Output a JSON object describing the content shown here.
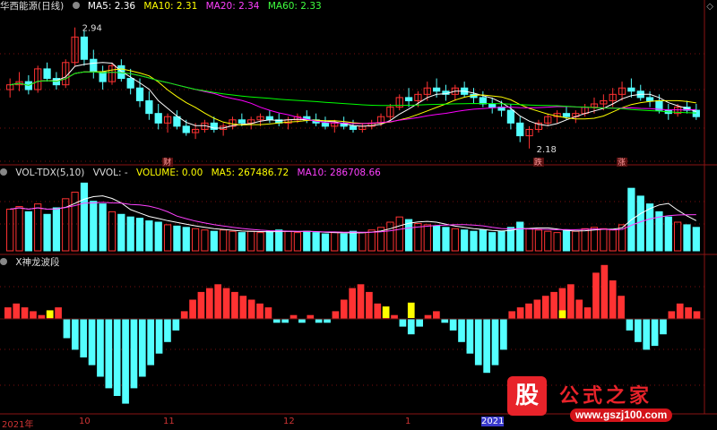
{
  "main_header": {
    "stock": "华西能源(日线)",
    "ma5": "MA5: 2.36",
    "ma10": "MA10: 2.31",
    "ma20": "MA20: 2.34",
    "ma60": "MA60: 2.33"
  },
  "vol_header": {
    "name": "VOL-TDX(5,10)",
    "vvol": "VVOL: -",
    "volume": "VOLUME: 0.00",
    "ma5": "MA5: 267486.72",
    "ma10": "MA10: 286708.66"
  },
  "ind_header": {
    "name": "X神龙波段"
  },
  "annotations": {
    "high": "2.94",
    "low": "2.18",
    "mark1": "财",
    "mark2": "跌",
    "mark3": "涨"
  },
  "x_axis": [
    "2021年",
    "10",
    "11",
    "12",
    "1",
    "2021"
  ],
  "colors": {
    "up": "#ff3232",
    "down": "#54ffff",
    "ma5": "#ffffff",
    "ma10": "#ffff00",
    "ma20": "#ff00ff",
    "ma60": "#00ff00",
    "yellow": "#ffff00"
  },
  "logo": {
    "mark": "股",
    "title": "公式之家",
    "url": "www.gszj100.com"
  },
  "chart_data": [
    {
      "type": "candlestick",
      "title": "华西能源(日线)",
      "series": [
        {
          "name": "K",
          "ohlc": [
            [
              2.55,
              2.62,
              2.5,
              2.58
            ],
            [
              2.58,
              2.66,
              2.54,
              2.6
            ],
            [
              2.6,
              2.64,
              2.52,
              2.55
            ],
            [
              2.55,
              2.7,
              2.53,
              2.68
            ],
            [
              2.68,
              2.72,
              2.6,
              2.62
            ],
            [
              2.62,
              2.66,
              2.55,
              2.58
            ],
            [
              2.58,
              2.74,
              2.56,
              2.72
            ],
            [
              2.72,
              2.94,
              2.7,
              2.88
            ],
            [
              2.88,
              2.92,
              2.7,
              2.74
            ],
            [
              2.74,
              2.8,
              2.62,
              2.66
            ],
            [
              2.66,
              2.7,
              2.55,
              2.6
            ],
            [
              2.6,
              2.72,
              2.58,
              2.7
            ],
            [
              2.7,
              2.74,
              2.6,
              2.62
            ],
            [
              2.62,
              2.68,
              2.52,
              2.56
            ],
            [
              2.56,
              2.62,
              2.44,
              2.48
            ],
            [
              2.48,
              2.54,
              2.36,
              2.4
            ],
            [
              2.4,
              2.46,
              2.3,
              2.34
            ],
            [
              2.34,
              2.4,
              2.28,
              2.38
            ],
            [
              2.38,
              2.42,
              2.3,
              2.32
            ],
            [
              2.32,
              2.36,
              2.26,
              2.28
            ],
            [
              2.28,
              2.34,
              2.24,
              2.3
            ],
            [
              2.3,
              2.36,
              2.28,
              2.34
            ],
            [
              2.34,
              2.38,
              2.28,
              2.3
            ],
            [
              2.3,
              2.34,
              2.26,
              2.32
            ],
            [
              2.32,
              2.38,
              2.3,
              2.36
            ],
            [
              2.36,
              2.4,
              2.32,
              2.34
            ],
            [
              2.34,
              2.38,
              2.3,
              2.36
            ],
            [
              2.36,
              2.4,
              2.32,
              2.38
            ],
            [
              2.38,
              2.42,
              2.34,
              2.36
            ],
            [
              2.36,
              2.4,
              2.32,
              2.34
            ],
            [
              2.34,
              2.38,
              2.3,
              2.36
            ],
            [
              2.36,
              2.4,
              2.34,
              2.38
            ],
            [
              2.38,
              2.42,
              2.34,
              2.36
            ],
            [
              2.36,
              2.4,
              2.32,
              2.34
            ],
            [
              2.34,
              2.38,
              2.3,
              2.32
            ],
            [
              2.32,
              2.36,
              2.28,
              2.34
            ],
            [
              2.34,
              2.38,
              2.3,
              2.32
            ],
            [
              2.32,
              2.36,
              2.28,
              2.3
            ],
            [
              2.3,
              2.34,
              2.28,
              2.32
            ],
            [
              2.32,
              2.36,
              2.3,
              2.34
            ],
            [
              2.34,
              2.4,
              2.32,
              2.38
            ],
            [
              2.38,
              2.46,
              2.36,
              2.44
            ],
            [
              2.44,
              2.52,
              2.42,
              2.5
            ],
            [
              2.5,
              2.56,
              2.44,
              2.48
            ],
            [
              2.48,
              2.54,
              2.44,
              2.52
            ],
            [
              2.52,
              2.6,
              2.48,
              2.56
            ],
            [
              2.56,
              2.62,
              2.5,
              2.54
            ],
            [
              2.54,
              2.58,
              2.48,
              2.52
            ],
            [
              2.52,
              2.58,
              2.48,
              2.56
            ],
            [
              2.56,
              2.6,
              2.5,
              2.52
            ],
            [
              2.52,
              2.56,
              2.46,
              2.5
            ],
            [
              2.5,
              2.54,
              2.44,
              2.46
            ],
            [
              2.46,
              2.5,
              2.4,
              2.44
            ],
            [
              2.44,
              2.48,
              2.38,
              2.42
            ],
            [
              2.42,
              2.46,
              2.3,
              2.34
            ],
            [
              2.34,
              2.38,
              2.22,
              2.26
            ],
            [
              2.26,
              2.32,
              2.18,
              2.3
            ],
            [
              2.3,
              2.36,
              2.28,
              2.34
            ],
            [
              2.34,
              2.4,
              2.32,
              2.38
            ],
            [
              2.38,
              2.42,
              2.34,
              2.4
            ],
            [
              2.4,
              2.44,
              2.36,
              2.38
            ],
            [
              2.38,
              2.42,
              2.34,
              2.4
            ],
            [
              2.4,
              2.46,
              2.38,
              2.44
            ],
            [
              2.44,
              2.5,
              2.4,
              2.46
            ],
            [
              2.46,
              2.52,
              2.42,
              2.48
            ],
            [
              2.48,
              2.56,
              2.44,
              2.52
            ],
            [
              2.52,
              2.6,
              2.48,
              2.56
            ],
            [
              2.56,
              2.62,
              2.5,
              2.54
            ],
            [
              2.54,
              2.58,
              2.48,
              2.5
            ],
            [
              2.5,
              2.54,
              2.44,
              2.48
            ],
            [
              2.48,
              2.52,
              2.4,
              2.42
            ],
            [
              2.42,
              2.46,
              2.36,
              2.4
            ],
            [
              2.4,
              2.46,
              2.38,
              2.44
            ],
            [
              2.44,
              2.48,
              2.4,
              2.42
            ],
            [
              2.42,
              2.46,
              2.36,
              2.38
            ]
          ]
        }
      ],
      "ylim": [
        2.1,
        3.0
      ]
    },
    {
      "type": "bar",
      "title": "VOL-TDX(5,10)",
      "series": [
        {
          "name": "VOLUME",
          "values": [
            32,
            34,
            30,
            36,
            28,
            33,
            40,
            45,
            52,
            38,
            36,
            30,
            28,
            26,
            25,
            23,
            22,
            20,
            19,
            18,
            17,
            16,
            15,
            16,
            15,
            14,
            15,
            14,
            15,
            16,
            15,
            14,
            15,
            14,
            13,
            14,
            13,
            15,
            14,
            16,
            18,
            22,
            26,
            24,
            21,
            20,
            19,
            18,
            17,
            16,
            15,
            16,
            14,
            15,
            18,
            22,
            17,
            16,
            15,
            14,
            16,
            15,
            17,
            18,
            17,
            16,
            20,
            48,
            42,
            36,
            30,
            26,
            22,
            20,
            18
          ]
        }
      ],
      "ylim": [
        0,
        55
      ]
    },
    {
      "type": "bar",
      "title": "X神龙波段",
      "series": [
        {
          "name": "X神龙波段",
          "values": [
            3,
            4,
            3,
            2,
            1,
            2,
            3,
            -5,
            -8,
            -10,
            -12,
            -15,
            -18,
            -20,
            -22,
            -18,
            -15,
            -12,
            -9,
            -6,
            -3,
            2,
            5,
            7,
            8,
            9,
            8,
            7,
            6,
            5,
            4,
            3,
            -1,
            -1,
            1,
            -1,
            1,
            -1,
            -1,
            2,
            5,
            8,
            9,
            7,
            4,
            2,
            1,
            -2,
            -4,
            -2,
            1,
            2,
            -1,
            -3,
            -6,
            -9,
            -12,
            -14,
            -12,
            -8,
            2,
            3,
            4,
            5,
            6,
            7,
            8,
            9,
            5,
            3,
            12,
            14,
            10,
            6,
            -3,
            -6,
            -8,
            -7,
            -4,
            2,
            4,
            3,
            2
          ]
        }
      ],
      "ylim": [
        -25,
        15
      ]
    }
  ]
}
